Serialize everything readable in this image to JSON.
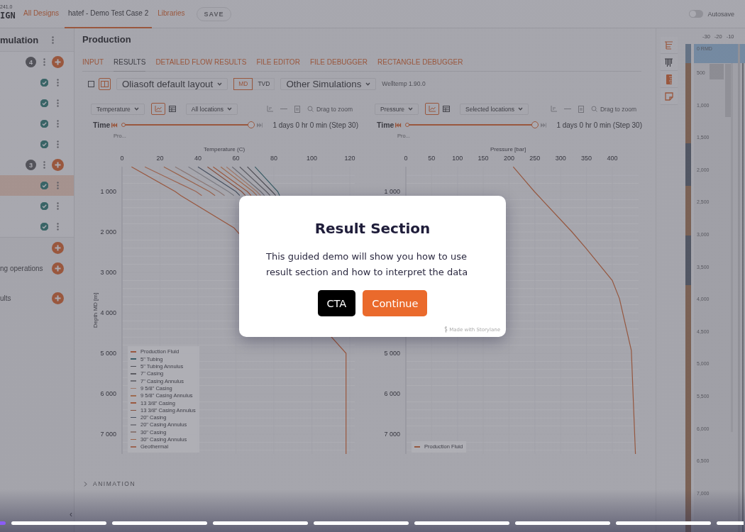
{
  "top_bar": {
    "version": "241.0",
    "logo": "IGN",
    "links": [
      {
        "label": "All Designs",
        "selected": false
      },
      {
        "label": "hatef - Demo Test Case 2",
        "selected": true
      },
      {
        "label": "Libraries",
        "selected": false
      }
    ],
    "save_button": {
      "label": "SAVE",
      "disabled": true
    },
    "autosave": {
      "label": "Autosave",
      "on": false
    }
  },
  "sidebar": {
    "title": "mulation",
    "items": [
      {
        "kind": "group",
        "badge": "4"
      },
      {
        "kind": "simulation",
        "done": true,
        "selected": false
      },
      {
        "kind": "simulation",
        "done": true,
        "selected": false
      },
      {
        "kind": "simulation",
        "done": true,
        "selected": false
      },
      {
        "kind": "simulation",
        "done": true,
        "selected": false
      },
      {
        "kind": "group",
        "badge": "3"
      },
      {
        "kind": "simulation",
        "done": true,
        "selected": true
      },
      {
        "kind": "simulation",
        "done": true,
        "selected": false
      },
      {
        "kind": "simulation",
        "done": true,
        "selected": false
      },
      {
        "kind": "section"
      },
      {
        "kind": "section",
        "label": "ng operations"
      },
      {
        "kind": "section",
        "label": "ults"
      }
    ],
    "collapse_button": "‹"
  },
  "main": {
    "title": "Production",
    "tabs": [
      {
        "label": "INPUT",
        "selected": false
      },
      {
        "label": "RESULTS",
        "selected": true
      },
      {
        "label": "DETAILED FLOW RESULTS",
        "selected": false
      },
      {
        "label": "FILE EDITOR",
        "selected": false
      },
      {
        "label": "FILE DEBUGGER",
        "selected": false
      },
      {
        "label": "RECTANGLE DEBUGGER",
        "selected": false
      }
    ],
    "toolbar": {
      "layouts": [
        {
          "kind": "single",
          "selected": false
        },
        {
          "kind": "split",
          "selected": true
        }
      ],
      "layout_select": "Oliasoft default layout",
      "depth_modes": [
        {
          "label": "MD",
          "selected": true
        },
        {
          "label": "TVD",
          "selected": false
        }
      ],
      "simulations_select": "Other Simulations",
      "version": "Welltemp 1.90.0"
    },
    "panels": [
      {
        "variable_select": "Temperature",
        "views": [
          {
            "kind": "chart",
            "selected": true
          },
          {
            "kind": "table",
            "selected": false
          }
        ],
        "locations_select": "All locations",
        "zoom_hint": "Drag to zoom",
        "time": {
          "label": "Time",
          "level": 1,
          "reading": "1 days 0 hr 0 min (Step 30)",
          "caption": "Pro..."
        },
        "chart_data": {
          "type": "line",
          "orientation": "horizontal",
          "grid": true,
          "legend": true,
          "xlabel": "Temperature (C)",
          "ylabel": "Depth MD [m]",
          "x": [
            390,
            1000,
            1100,
            1900,
            5000,
            6000,
            7000,
            7490
          ],
          "xlim": [
            0,
            122.6
          ],
          "ylim": [
            7491,
            386
          ],
          "xticks": [
            0,
            20,
            40,
            60,
            80,
            100,
            120
          ],
          "yticks": [
            {
              "value": 1000,
              "label": "1 000"
            },
            {
              "value": 2000,
              "label": "2 000"
            },
            {
              "value": 3000,
              "label": "3 000"
            },
            {
              "value": 4000,
              "label": "4 000"
            },
            {
              "value": 5000,
              "label": "5 000"
            },
            {
              "value": 6000,
              "label": "6 000"
            },
            {
              "value": 7000,
              "label": "7 000"
            }
          ],
          "series": [
            {
              "name": "Production Fluid",
              "color": "#99573e",
              "values": [
                5,
                28,
                31,
                59,
                118,
                118,
                118,
                118
              ]
            },
            {
              "name": "5\" Tubing",
              "color": "#395c65",
              "values": [
                70,
                82,
                83,
                null,
                null,
                null,
                null,
                null
              ]
            },
            {
              "name": "5\" Tubing Annulus",
              "color": "#4e4e55",
              "values": [
                66,
                79,
                81,
                null,
                null,
                null,
                null,
                null
              ]
            },
            {
              "name": "7\" Casing",
              "color": "#5c5c63",
              "values": [
                62,
                76,
                78,
                null,
                null,
                null,
                null,
                null
              ]
            },
            {
              "name": "7\" Casing Annulus",
              "color": "#6c6c73",
              "values": [
                58,
                73,
                75,
                null,
                null,
                null,
                null,
                null
              ]
            },
            {
              "name": "9 5/8\" Casing",
              "color": "#9e786a",
              "values": [
                55,
                71,
                73,
                null,
                null,
                null,
                null,
                null
              ]
            },
            {
              "name": "9 5/8\" Casing Annulus",
              "color": "#9e6b50",
              "values": [
                52,
                69,
                71,
                null,
                null,
                null,
                null,
                null
              ]
            },
            {
              "name": "13 3/8\" Casing",
              "color": "#9b593f",
              "values": [
                48,
                66,
                68,
                null,
                null,
                null,
                null,
                null
              ]
            },
            {
              "name": "13 3/8\" Casing Annulus",
              "color": "#845141",
              "values": [
                45,
                63,
                65,
                null,
                null,
                null,
                null,
                null
              ]
            },
            {
              "name": "20\" Casing",
              "color": "#485160",
              "values": [
                40,
                60,
                62,
                null,
                null,
                null,
                null,
                null
              ]
            },
            {
              "name": "20\" Casing Annulus",
              "color": "#7b7b82",
              "values": [
                35,
                56,
                59,
                null,
                null,
                null,
                null,
                null
              ]
            },
            {
              "name": "30\" Casing",
              "color": "#8a7774",
              "values": [
                28,
                51,
                54,
                null,
                null,
                null,
                null,
                null
              ]
            },
            {
              "name": "30\" Casing Annulus",
              "color": "#99624a",
              "values": [
                22,
                46,
                49,
                null,
                null,
                null,
                null,
                null
              ]
            },
            {
              "name": "Geothermal",
              "color": "#9c6552",
              "values": [
                12,
                39,
                42,
                null,
                null,
                null,
                null,
                null
              ]
            }
          ]
        }
      },
      {
        "variable_select": "Pressure",
        "views": [
          {
            "kind": "chart",
            "selected": true
          },
          {
            "kind": "table",
            "selected": false
          }
        ],
        "locations_select": "Selected locations",
        "zoom_hint": "Drag to zoom",
        "time": {
          "label": "Time",
          "level": 1,
          "reading": "1 days 0 hr 0 min (Step 30)",
          "caption": "Pro..."
        },
        "chart_data": {
          "type": "line",
          "orientation": "horizontal",
          "grid": true,
          "legend": true,
          "xlabel": "Pressure [bar]",
          "x": [
            390,
            1000,
            2000,
            2400,
            3200,
            3650,
            4930,
            7490
          ],
          "xlim": [
            0,
            451
          ],
          "ylim": [
            7491,
            386
          ],
          "xticks": [
            0,
            50,
            100,
            150,
            200,
            250,
            300,
            350,
            400
          ],
          "yticks": [
            {
              "value": 1000,
              "label": "1 000"
            },
            {
              "value": 5000,
              "label": "5 000"
            },
            {
              "value": 6000,
              "label": "6 000"
            },
            {
              "value": 7000,
              "label": "7 000"
            }
          ],
          "series": [
            {
              "name": "Production Fluid",
              "color": "#95573f",
              "values": [
                208,
                249,
                322,
                349,
                400,
                414,
                437,
                445
              ]
            }
          ]
        }
      }
    ],
    "animation": {
      "label": "ANIMATION",
      "expanded": false
    }
  },
  "icon_rail": [
    {
      "kind": "tree",
      "selected": false
    },
    {
      "kind": "wells",
      "selected": true
    },
    {
      "kind": "ruler",
      "selected": false
    },
    {
      "kind": "note",
      "selected": false
    }
  ],
  "well_schematic": {
    "scale": [
      "-30",
      "-20",
      "-10"
    ],
    "top_label": "0 RMD",
    "depths": [
      "500",
      "1,000",
      "1,500",
      "2,000",
      "2,500",
      "3,000",
      "3,500",
      "4,000",
      "4,500",
      "5,000",
      "5,500",
      "6,000",
      "6,500",
      "7,000"
    ]
  },
  "guide": {
    "title": "Result Section",
    "body": "This guided demo will show you how to use result section and how to interpret the data",
    "buttons": [
      {
        "label": "CTA",
        "kind": "secondary"
      },
      {
        "label": "Continue",
        "kind": "primary"
      }
    ],
    "branding": "Made with Storylane"
  },
  "story_progress": [
    {
      "selected": true
    },
    {
      "selected": false
    },
    {
      "selected": false
    },
    {
      "selected": false
    },
    {
      "selected": false
    },
    {
      "selected": false
    },
    {
      "selected": false
    },
    {
      "selected": false
    },
    {
      "selected": false
    }
  ]
}
